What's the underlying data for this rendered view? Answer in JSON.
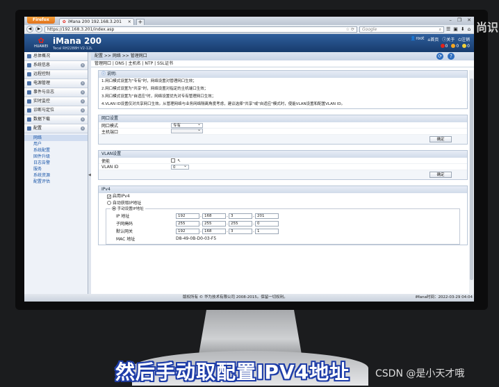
{
  "browser": {
    "firefox_label": "Firefox",
    "tab_title": "iMana 200 192.168.3.201",
    "tab_add": "+",
    "url": "https://192.168.3.201/index.asp",
    "search_placeholder": "Google",
    "window_controls": [
      "–",
      "❐",
      "✕"
    ]
  },
  "header": {
    "brand": "HUAWEI",
    "product": "iMana 200",
    "model": "Tecal RH2288H V2-12L",
    "user": "root",
    "home": "首页",
    "about": "关于",
    "logout": "注销",
    "alarm_counts": [
      "0",
      "0",
      "0"
    ],
    "alarm_colors": [
      "#e2231a",
      "#f5a623",
      "#f2d13a"
    ]
  },
  "sidebar": {
    "items": [
      {
        "label": "总体概况"
      },
      {
        "label": "系统信息"
      },
      {
        "label": "远程控制"
      },
      {
        "label": "电源管理"
      },
      {
        "label": "事件与日志"
      },
      {
        "label": "实时监控"
      },
      {
        "label": "诊断与定位"
      },
      {
        "label": "数据下载"
      },
      {
        "label": "配置"
      }
    ],
    "sub_items": [
      "网络",
      "用户",
      "系统配置",
      "固件升级",
      "日志告警",
      "服务",
      "系统资源",
      "配置评估"
    ]
  },
  "main": {
    "breadcrumb": "配置  >>  网络  >>  管理网口",
    "subtabs": "管理网口 | DNS | 主机名 | NTP | SSL证书",
    "note": {
      "title": "说明:",
      "lines": [
        "1.网口模式设置为\"专有\"时，网络设置对管理网口生效；",
        "2.网口模式设置为\"共享\"时，网络设置对指定的主机端口生效；",
        "3.网口模式设置为\"自适应\"时，网络设置优先对专有管理网口生效；",
        "4.VLAN ID设置仅对共享网口生效。从管理网络与业务网络隔离角度考虑，建议选择\"共享\"或\"自适应\"模式时，使能VLAN设置和配置VLAN ID。"
      ]
    },
    "port": {
      "title": "网口设置",
      "mode_label": "网口模式",
      "mode_value": "专有",
      "host_label": "主机端口",
      "host_value": "",
      "confirm": "确定"
    },
    "vlan": {
      "title": "VLAN设置",
      "enable_label": "使能",
      "id_label": "VLAN ID",
      "id_value": "0",
      "confirm": "确定"
    },
    "ipv4": {
      "title": "IPv4",
      "enable_label": "启用IPv4",
      "auto_label": "自动获取IP地址",
      "manual_label": "手动设置IP地址",
      "ip_label": "IP 地址",
      "ip": [
        "192",
        "168",
        "3",
        "201"
      ],
      "mask_label": "子网掩码",
      "mask": [
        "255",
        "255",
        "255",
        "0"
      ],
      "gw_label": "默认网关",
      "gw": [
        "192",
        "168",
        "3",
        "1"
      ],
      "mac_label": "MAC 地址",
      "mac": "D8-49-0B-D0-03-F5"
    }
  },
  "footer": {
    "copyright": "版权所有 © 华为技术有限公司 2008-2015。保留一切权利。",
    "time": "iMana时间：2022-03-29 04:04"
  },
  "overlay": {
    "subtitle": "然后手动取配置IPV4地址",
    "watermark": "CSDN @是小天才哦",
    "side_text": "尚识"
  }
}
